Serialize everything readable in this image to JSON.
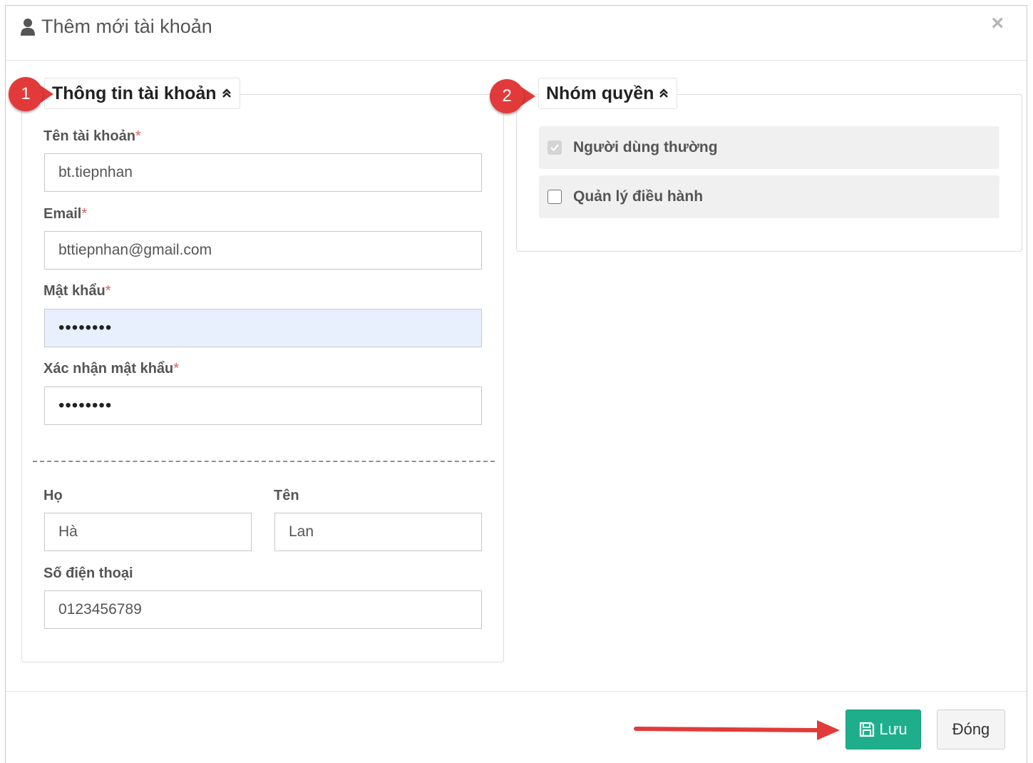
{
  "dialog": {
    "title": "Thêm mới tài khoản",
    "close_glyph": "×"
  },
  "account_panel": {
    "legend": "Thông tin tài khoản",
    "fields": {
      "username": {
        "label": "Tên tài khoản",
        "value": "bt.tiepnhan"
      },
      "email": {
        "label": "Email",
        "value": "bttiepnhan@gmail.com"
      },
      "password": {
        "label": "Mật khẩu",
        "value": "••••••••"
      },
      "confirm_password": {
        "label": "Xác nhận mật khẩu",
        "value": "••••••••"
      },
      "last_name": {
        "label": "Họ",
        "value": "Hà"
      },
      "first_name": {
        "label": "Tên",
        "value": "Lan"
      },
      "phone": {
        "label": "Số điện thoại",
        "value": "0123456789"
      }
    },
    "required_mark": "*"
  },
  "permission_panel": {
    "legend": "Nhóm quyền",
    "items": [
      {
        "label": "Người dùng thường",
        "checked": true,
        "disabled": true
      },
      {
        "label": "Quản lý điều hành",
        "checked": false,
        "disabled": false
      }
    ]
  },
  "annotations": {
    "badge_1": "1",
    "badge_2": "2"
  },
  "footer": {
    "save_label": "Lưu",
    "close_label": "Đóng"
  },
  "colors": {
    "save_button": "#1fae8c",
    "annotation_red": "#e23a3a",
    "required": "#e05a5a"
  }
}
